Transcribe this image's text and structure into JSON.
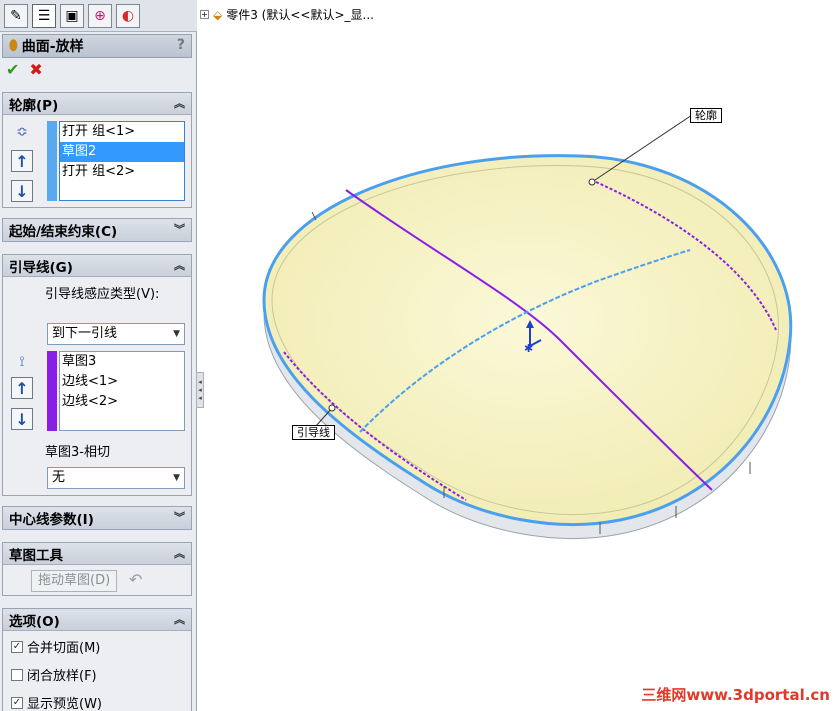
{
  "tabs": [
    {
      "name": "feature-manager-icon",
      "glyph": "✎"
    },
    {
      "name": "property-manager-icon",
      "glyph": "☰"
    },
    {
      "name": "configuration-manager-icon",
      "glyph": "▣"
    },
    {
      "name": "dimxpert-icon",
      "glyph": "⊕"
    },
    {
      "name": "display-manager-icon",
      "glyph": "◐"
    }
  ],
  "title": "曲面-放样",
  "help": "?",
  "ok_glyph": "✔",
  "cancel_glyph": "✖",
  "profile": {
    "header": "轮廓(P)",
    "items": [
      "打开 组<1>",
      "草图2",
      "打开 组<2>"
    ],
    "selected_index": 1,
    "color": "#5aa9f0"
  },
  "start_end": {
    "header": "起始/结束约束(C)"
  },
  "guides": {
    "header": "引导线(G)",
    "influence_label": "引导线感应类型(V):",
    "influence_value": "到下一引线",
    "items": [
      "草图3",
      "边线<1>",
      "边线<2>"
    ],
    "color": "#8a1ee8",
    "tangency_label": "草图3-相切",
    "tangency_value": "无"
  },
  "centerline": {
    "header": "中心线参数(I)"
  },
  "sketch_tools": {
    "header": "草图工具",
    "drag_label": "拖动草图(D)",
    "undo_glyph": "↶"
  },
  "options": {
    "header": "选项(O)",
    "merge": {
      "label": "合并切面(M)",
      "checked": true
    },
    "close": {
      "label": "闭合放样(F)",
      "checked": false
    },
    "preview": {
      "label": "显示预览(W)",
      "checked": true
    }
  },
  "tree_label": "零件3  (默认<<默认>_显...",
  "callouts": {
    "profile": "轮廓",
    "guide": "引导线"
  },
  "watermark": "三维网www.3dportal.cn"
}
